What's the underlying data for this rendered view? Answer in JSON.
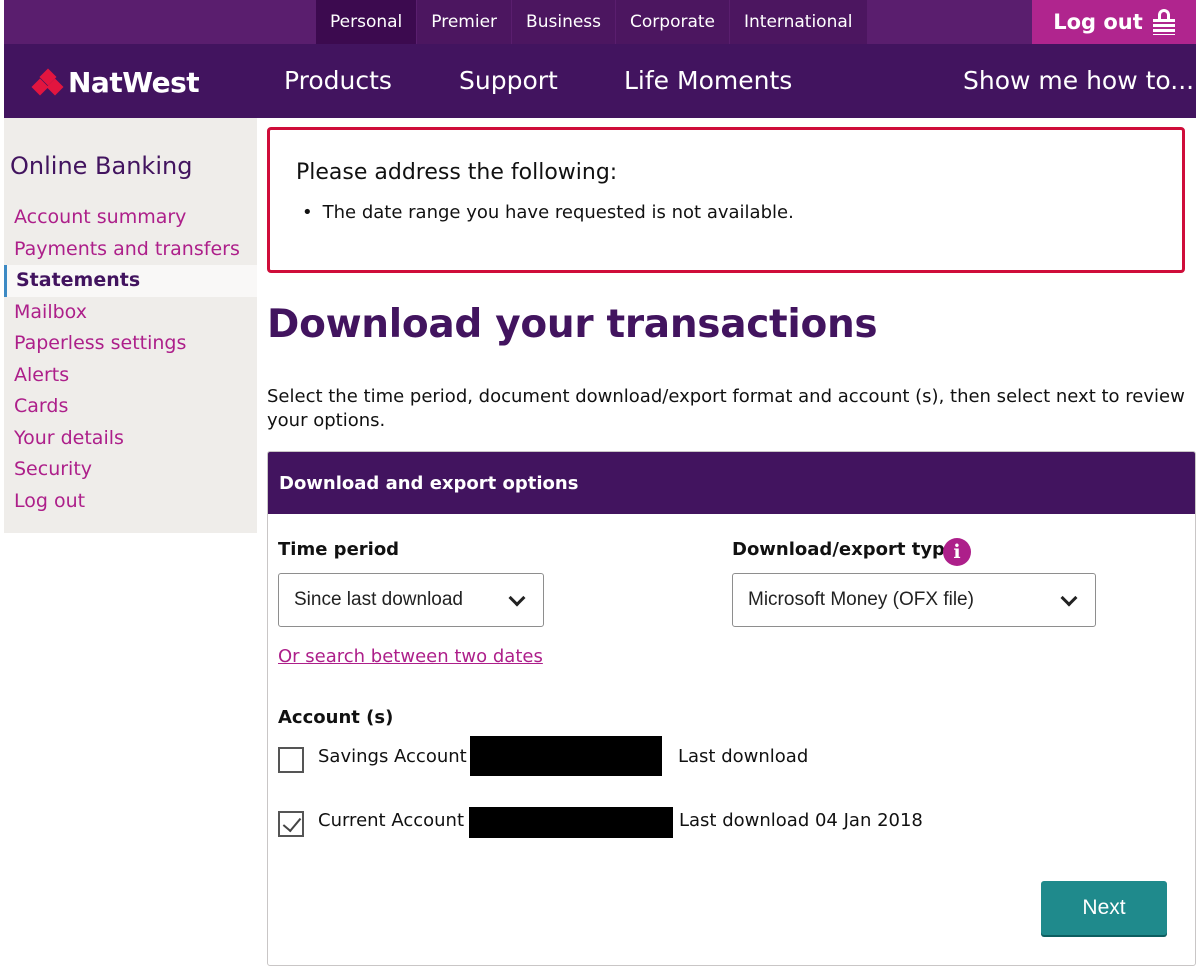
{
  "top_tabs": [
    {
      "label": "Personal",
      "active": true
    },
    {
      "label": "Premier",
      "active": false
    },
    {
      "label": "Business",
      "active": false
    },
    {
      "label": "Corporate",
      "active": false
    },
    {
      "label": "International",
      "active": false
    }
  ],
  "logout_top": {
    "label": "Log out",
    "icon": "lock-icon"
  },
  "brand": {
    "name": "NatWest",
    "icon": "natwest-logo-icon"
  },
  "main_nav": [
    {
      "label": "Products"
    },
    {
      "label": "Support"
    },
    {
      "label": "Life Moments"
    },
    {
      "label": "Show me how to..."
    }
  ],
  "sidebar": {
    "title": "Online Banking",
    "items": [
      {
        "label": "Account summary",
        "active": false
      },
      {
        "label": "Payments and transfers",
        "active": false
      },
      {
        "label": "Statements",
        "active": true
      },
      {
        "label": "Mailbox",
        "active": false
      },
      {
        "label": "Paperless settings",
        "active": false
      },
      {
        "label": "Alerts",
        "active": false
      },
      {
        "label": "Cards",
        "active": false
      },
      {
        "label": "Your details",
        "active": false
      },
      {
        "label": "Security",
        "active": false
      },
      {
        "label": "Log out",
        "active": false
      }
    ]
  },
  "error": {
    "heading": "Please address the following:",
    "messages": [
      "The date range you have requested is not available."
    ]
  },
  "page": {
    "title": "Download your transactions",
    "intro": "Select the time period, document download/export format and account (s), then select next to review your options."
  },
  "panel": {
    "heading": "Download and export options",
    "time_period": {
      "label": "Time period",
      "value": "Since last download"
    },
    "export_type": {
      "label": "Download/export type",
      "value": "Microsoft Money (OFX file)",
      "info_icon": "info-icon"
    },
    "search_link": "Or search between two dates",
    "accounts_label": "Account (s)",
    "accounts": [
      {
        "name": "Savings Account",
        "checked": false,
        "last_download": "Last download"
      },
      {
        "name": "Current Account",
        "checked": true,
        "last_download": "Last download 04 Jan 2018"
      }
    ],
    "next_label": "Next"
  },
  "colors": {
    "brand_purple": "#42145f",
    "accent_magenta": "#ad1f8a",
    "error_red": "#cf0d3a",
    "button_teal": "#1f8a8c"
  }
}
